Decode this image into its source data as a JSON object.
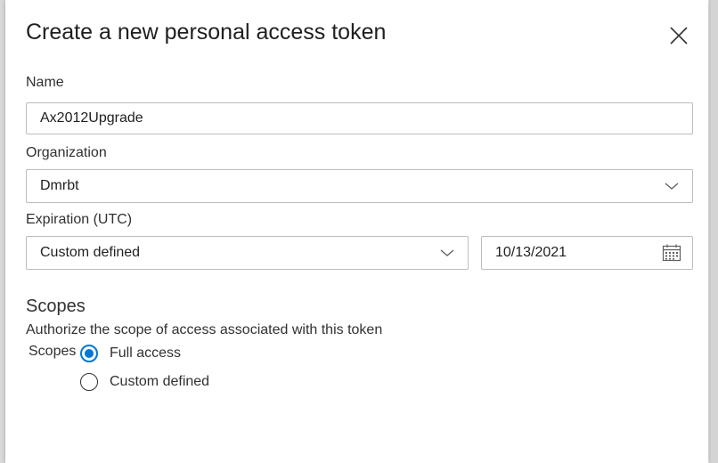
{
  "dialog": {
    "title": "Create a new personal access token"
  },
  "form": {
    "name": {
      "label": "Name",
      "value": "Ax2012Upgrade"
    },
    "organization": {
      "label": "Organization",
      "selected": "Dmrbt"
    },
    "expiration": {
      "label": "Expiration (UTC)",
      "selected": "Custom defined",
      "date": "10/13/2021"
    }
  },
  "scopes": {
    "heading": "Scopes",
    "description": "Authorize the scope of access associated with this token",
    "label": "Scopes",
    "options": [
      {
        "label": "Full access",
        "checked": true
      },
      {
        "label": "Custom defined",
        "checked": false
      }
    ]
  },
  "colors": {
    "accent": "#0078d4",
    "border": "#bdbdbd",
    "text": "#323130"
  },
  "icons": {
    "close": "close-icon",
    "dropdown": "chevron-down-icon",
    "calendar": "calendar-icon"
  }
}
